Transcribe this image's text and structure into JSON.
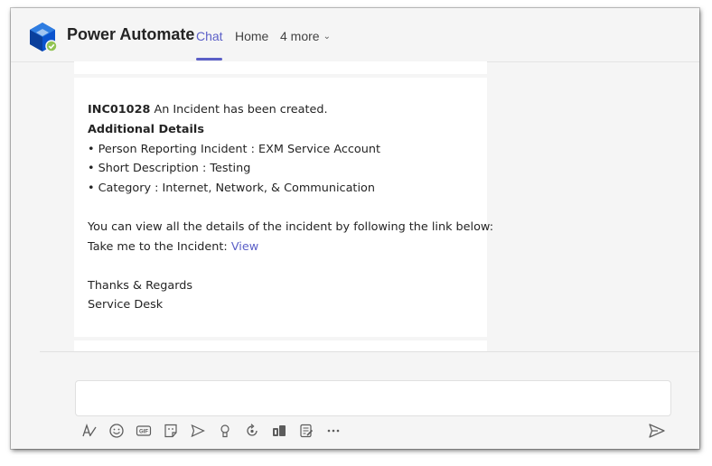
{
  "header": {
    "app_name": "Power Automate",
    "tabs": [
      {
        "label": "Chat",
        "active": true
      },
      {
        "label": "Home",
        "active": false
      },
      {
        "label": "4 more",
        "active": false
      }
    ]
  },
  "message": {
    "incident_id": "INC01028",
    "incident_text": " An Incident has been created.",
    "details_heading": "Additional Details",
    "bullets": [
      "• Person Reporting Incident : EXM Service Account",
      "• Short Description : Testing",
      "• Category : Internet, Network, & Communication"
    ],
    "view_info": "You can view all the details of the incident by following the link below:",
    "take_me": "Take me to the Incident: ",
    "link_text": "View",
    "closing": "Thanks & Regards",
    "signature": "Service Desk"
  },
  "composer": {
    "toolbar_icons": [
      "format-icon",
      "emoji-icon",
      "gif-icon",
      "sticker-icon",
      "schedule-meeting-icon",
      "praise-icon",
      "loop-icon",
      "app-icon",
      "approvals-icon",
      "more-options-icon"
    ],
    "send_icon": "send-icon"
  },
  "colors": {
    "accent": "#5b5fc7",
    "background": "#f5f5f5",
    "card": "#ffffff",
    "text": "#242424"
  }
}
